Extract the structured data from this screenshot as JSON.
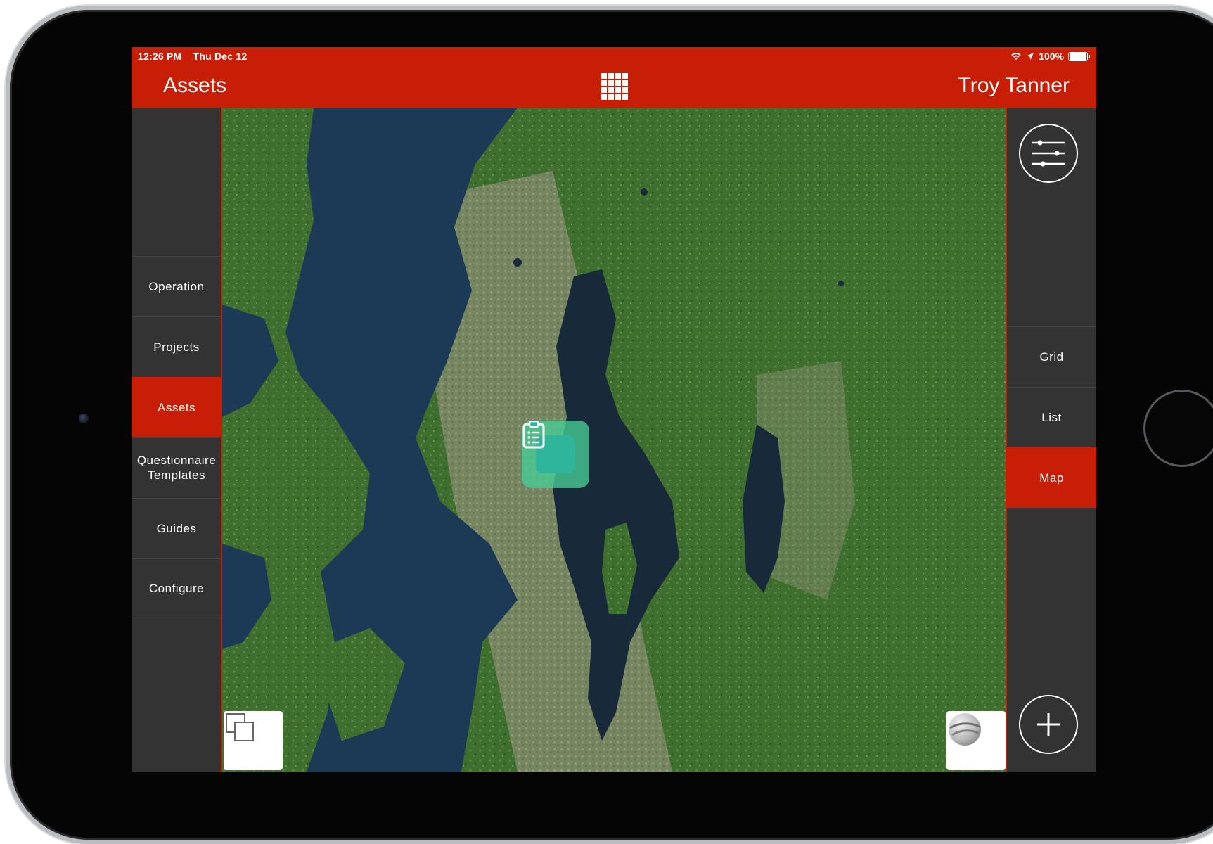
{
  "status_bar": {
    "time": "12:26 PM",
    "date": "Thu Dec 12",
    "battery": "100%"
  },
  "header": {
    "title": "Assets",
    "user_name": "Troy Tanner",
    "apps_icon": "grid-icon"
  },
  "left_nav": {
    "items": [
      {
        "label": "Operation",
        "active": false
      },
      {
        "label": "Projects",
        "active": false
      },
      {
        "label": "Assets",
        "active": true
      },
      {
        "label": "Questionnaire Templates",
        "active": false
      },
      {
        "label": "Guides",
        "active": false
      },
      {
        "label": "Configure",
        "active": false
      }
    ]
  },
  "right_nav": {
    "filter_icon": "sliders-icon",
    "view_modes": [
      {
        "label": "Grid",
        "active": false
      },
      {
        "label": "List",
        "active": false
      },
      {
        "label": "Map",
        "active": true
      }
    ],
    "add_icon": "plus-icon"
  },
  "map": {
    "type": "satellite",
    "marker_icon": "clipboard-icon",
    "layers_button_icon": "layers-icon",
    "earth_button_icon": "globe-icon"
  },
  "colors": {
    "accent": "#c81e06",
    "panel": "#333333",
    "marker": "#46cd96"
  }
}
